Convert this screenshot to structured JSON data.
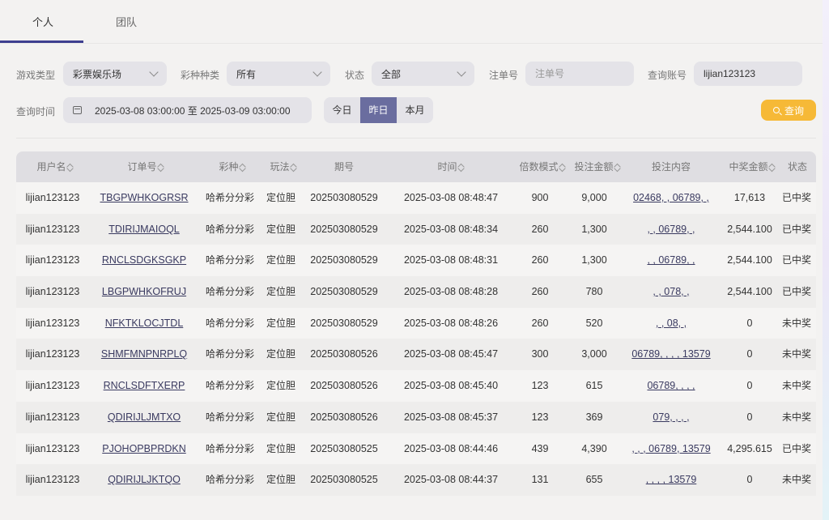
{
  "tabs": [
    "个人",
    "团队"
  ],
  "filters": {
    "game_type_label": "游戏类型",
    "game_type_value": "彩票娱乐场",
    "lottery_kind_label": "彩种种类",
    "lottery_kind_value": "所有",
    "status_label": "状态",
    "status_value": "全部",
    "order_label": "注单号",
    "order_placeholder": "注单号",
    "account_label": "查询账号",
    "account_value": "lijian123123",
    "time_label": "查询时间",
    "time_range": "2025-03-08 03:00:00 至 2025-03-09 03:00:00",
    "quick_ranges": [
      "今日",
      "昨日",
      "本月"
    ],
    "active_quick_range": "昨日",
    "query_button": "查询"
  },
  "table": {
    "headers": [
      "用户名",
      "订单号",
      "彩种",
      "玩法",
      "期号",
      "时间",
      "倍数模式",
      "投注金额",
      "投注内容",
      "中奖金额",
      "状态"
    ],
    "rows": [
      [
        "lijian123123",
        "TBGPWHKOGRSR",
        "哈希分分彩",
        "定位胆",
        "202503080529",
        "2025-03-08 08:48:47",
        "900",
        "9,000",
        "02468, , 06789, ,",
        "17,613",
        "已中奖"
      ],
      [
        "lijian123123",
        "TDIRIJMAIOQL",
        "哈希分分彩",
        "定位胆",
        "202503080529",
        "2025-03-08 08:48:34",
        "260",
        "1,300",
        ", , 06789, ,",
        "2,544.100",
        "已中奖"
      ],
      [
        "lijian123123",
        "RNCLSDGKSGKP",
        "哈希分分彩",
        "定位胆",
        "202503080529",
        "2025-03-08 08:48:31",
        "260",
        "1,300",
        ", , 06789, ,",
        "2,544.100",
        "已中奖"
      ],
      [
        "lijian123123",
        "LBGPWHKOFRUJ",
        "哈希分分彩",
        "定位胆",
        "202503080529",
        "2025-03-08 08:48:28",
        "260",
        "780",
        ", , 078, ,",
        "2,544.100",
        "已中奖"
      ],
      [
        "lijian123123",
        "NFKTKLOCJTDL",
        "哈希分分彩",
        "定位胆",
        "202503080529",
        "2025-03-08 08:48:26",
        "260",
        "520",
        ", , 08, ,",
        "0",
        "未中奖"
      ],
      [
        "lijian123123",
        "SHMFMNPNRPLQ",
        "哈希分分彩",
        "定位胆",
        "202503080526",
        "2025-03-08 08:45:47",
        "300",
        "3,000",
        "06789, , , , 13579",
        "0",
        "未中奖"
      ],
      [
        "lijian123123",
        "RNCLSDFTXERP",
        "哈希分分彩",
        "定位胆",
        "202503080526",
        "2025-03-08 08:45:40",
        "123",
        "615",
        "06789, , , ,",
        "0",
        "未中奖"
      ],
      [
        "lijian123123",
        "QDIRIJLJMTXO",
        "哈希分分彩",
        "定位胆",
        "202503080526",
        "2025-03-08 08:45:37",
        "123",
        "369",
        "079, , , ,",
        "0",
        "未中奖"
      ],
      [
        "lijian123123",
        "PJOHOPBPRDKN",
        "哈希分分彩",
        "定位胆",
        "202503080525",
        "2025-03-08 08:44:46",
        "439",
        "4,390",
        ", , , 06789, 13579",
        "4,295.615",
        "已中奖"
      ],
      [
        "lijian123123",
        "QDIRIJLJKTQO",
        "哈希分分彩",
        "定位胆",
        "202503080525",
        "2025-03-08 08:44:37",
        "131",
        "655",
        ", , , , 13579",
        "0",
        "未中奖"
      ]
    ]
  }
}
